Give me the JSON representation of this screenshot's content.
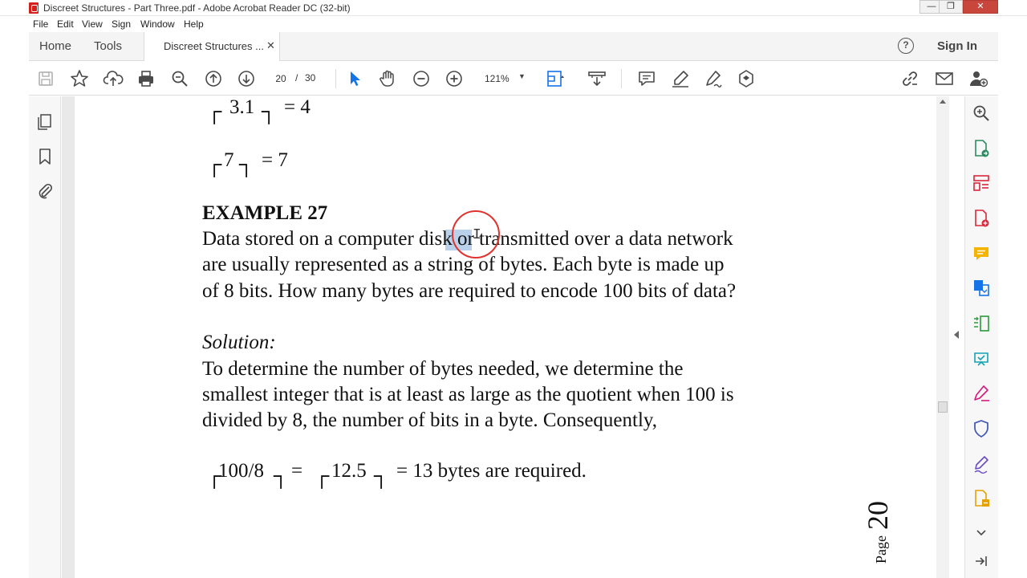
{
  "window": {
    "title": "Discreet Structures - Part Three.pdf - Adobe Acrobat Reader DC (32-bit)",
    "minimize": "—",
    "restore": "❐",
    "close": "✕"
  },
  "menu": [
    "File",
    "Edit",
    "View",
    "Sign",
    "Window",
    "Help"
  ],
  "tabs": {
    "home": "Home",
    "tools": "Tools",
    "document": "Discreet Structures ...",
    "document_close": "✕",
    "help": "?",
    "sign_in": "Sign In"
  },
  "toolbar": {
    "page_current": "20",
    "page_separator": "/",
    "page_total": "30",
    "zoom": "121%"
  },
  "document": {
    "ceil1_value": "3.1",
    "ceil1_result": "= 4",
    "ceil2_value": "7",
    "ceil2_result": "= 7",
    "example_heading": "EXAMPLE 27",
    "example_lines": [
      "Data stored on a computer disk or transmitted over a data network",
      "are usually represented as a string of bytes. Each byte is made up",
      "of 8 bits. How many bytes are required to encode 100 bits of data?"
    ],
    "solution_heading": "Solution:",
    "solution_lines": [
      "To determine the number of bytes needed, we determine the",
      "smallest integer that is at least as large as the quotient when 100 is",
      "divided by 8, the number of bits in a byte. Consequently,"
    ],
    "final_a": "100/8",
    "final_eq": "=",
    "final_b": "12.5",
    "final_result": "= 13 bytes are required.",
    "page_word": "Page",
    "page_number": "20"
  },
  "colors": {
    "acrobat_red": "#d4201d",
    "selection": "#b9d1ea",
    "cursor_ring": "#e0332e",
    "toolbar_icon": "#4a4a4a",
    "accent_blue": "#1473e6"
  },
  "icons": {
    "toolbar": [
      "save-icon",
      "bookmark-star-icon",
      "upload-icon",
      "print-icon",
      "zoom-search-icon",
      "page-up-icon",
      "page-down-icon",
      "select-arrow-icon",
      "hand-icon",
      "zoom-out-icon",
      "zoom-in-icon",
      "fit-page-icon",
      "scroll-mode-icon",
      "comment-icon",
      "highlight-pen-icon",
      "sign-pen-icon",
      "stamp-icon",
      "link-icon",
      "mail-icon",
      "add-user-icon"
    ],
    "left_panel": [
      "pages-icon",
      "bookmark-icon",
      "attachment-icon"
    ],
    "right_panel": [
      "search-zoom-icon",
      "export-pdf-icon",
      "organize-pages-icon",
      "create-pdf-icon",
      "comment-tool-icon",
      "combine-files-icon",
      "compress-icon",
      "send-review-icon",
      "fill-sign-icon",
      "protect-icon",
      "sign-icon",
      "more-tools-icon",
      "expand-chevron-icon",
      "collapse-panel-icon"
    ]
  }
}
